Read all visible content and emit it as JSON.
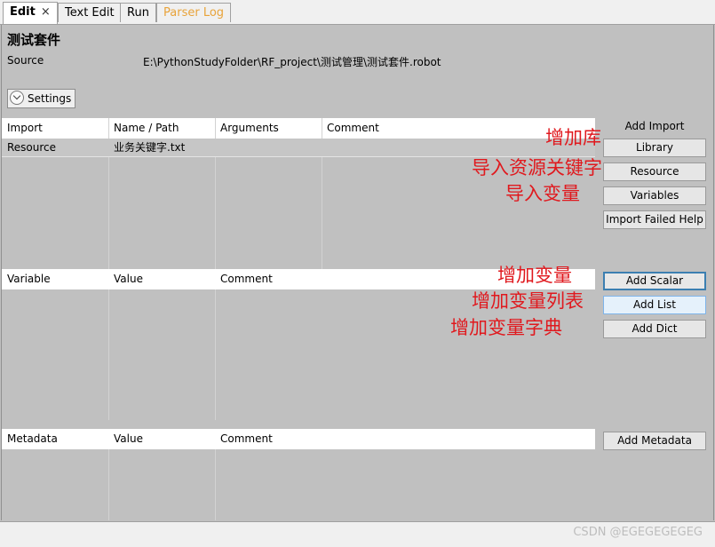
{
  "tabs": [
    {
      "label": "Edit",
      "close": "×"
    },
    {
      "label": "Text Edit"
    },
    {
      "label": "Run"
    },
    {
      "label": "Parser Log"
    }
  ],
  "suite": {
    "title": "测试套件",
    "source_label": "Source",
    "source_value": "E:\\PythonStudyFolder\\RF_project\\测试管理\\测试套件.robot"
  },
  "settings_label": "Settings",
  "import_table": {
    "headers": [
      "Import",
      "Name / Path",
      "Arguments",
      "Comment"
    ],
    "rows": [
      [
        "Resource",
        "业务关键字.txt",
        "",
        ""
      ]
    ]
  },
  "import_panel": {
    "label": "Add Import",
    "buttons": [
      "Library",
      "Resource",
      "Variables",
      "Import Failed Help"
    ]
  },
  "variable_table": {
    "headers": [
      "Variable",
      "Value",
      "Comment"
    ]
  },
  "variable_buttons": [
    "Add Scalar",
    "Add List",
    "Add Dict"
  ],
  "metadata_table": {
    "headers": [
      "Metadata",
      "Value",
      "Comment"
    ]
  },
  "metadata_button": "Add Metadata",
  "annotations": [
    "增加库",
    "导入资源关键字",
    "导入变量",
    "增加变量",
    "增加变量列表",
    "增加变量字典"
  ],
  "watermark": "CSDN @EGEGEGEGEG",
  "colors": {
    "annotation": "#e0191e",
    "parser_log_tab": "#e8a33a"
  }
}
